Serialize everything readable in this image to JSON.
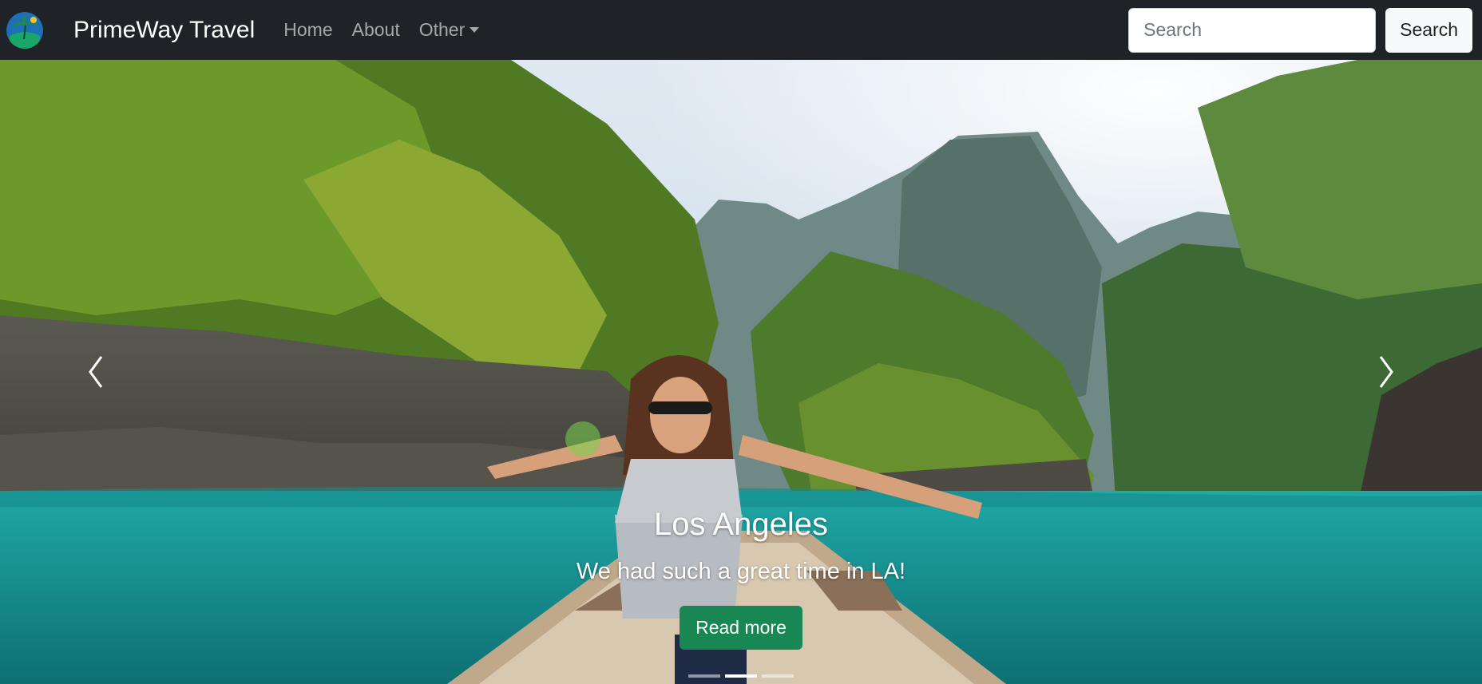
{
  "navbar": {
    "brand": "PrimeWay Travel",
    "links": [
      "Home",
      "About",
      "Other"
    ],
    "search_placeholder": "Search",
    "search_button": "Search"
  },
  "carousel": {
    "title": "Los Angeles",
    "text": "We had such a great time in LA!",
    "button": "Read more",
    "active_slide": 1,
    "slide_count": 3
  },
  "colors": {
    "navbar_bg": "#1f2226",
    "primary_button": "#198754",
    "water": "#1a9c9a"
  },
  "icons": {
    "logo": "globe-palm-logo",
    "prev": "chevron-left-icon",
    "next": "chevron-right-icon",
    "dropdown": "caret-down-icon"
  }
}
